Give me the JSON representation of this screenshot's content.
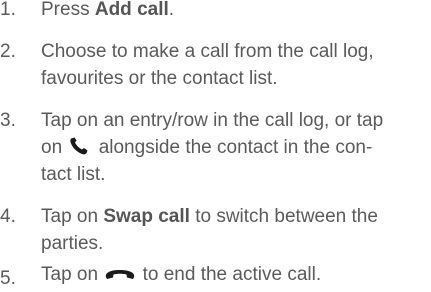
{
  "steps": [
    {
      "number": "1.",
      "text_before": "Press ",
      "bold": "Add call",
      "text_after": "."
    },
    {
      "number": "2.",
      "line1": "Choose to make a call from the call log,",
      "line2": "favourites or the contact list."
    },
    {
      "number": "3.",
      "line1": "Tap on an entry/row in the call log, or tap",
      "line2_before": "on ",
      "line2_after": " alongside the contact in the con-",
      "line3": "tact list.",
      "icon": "phone-handset-icon"
    },
    {
      "number": "4.",
      "line1_before": "Tap on ",
      "line1_bold": "Swap call",
      "line1_after": " to switch between the",
      "line2": "parties."
    },
    {
      "number": "5.",
      "text_before": "Tap on ",
      "text_after": " to end the active call.",
      "icon": "end-call-icon"
    }
  ],
  "colors": {
    "text": "#5a5a5a",
    "icon": "#1a1a1a"
  }
}
